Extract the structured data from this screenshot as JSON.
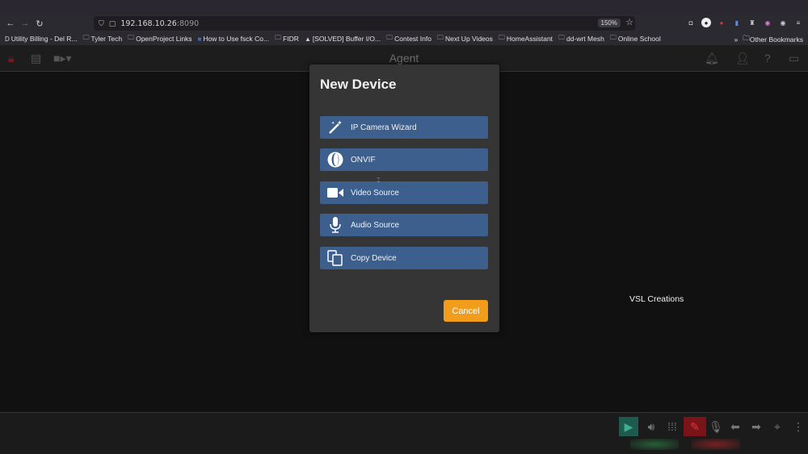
{
  "browser": {
    "url": "192.168.10.26",
    "url_port": ":8090",
    "zoom": "150%",
    "bookmarks": [
      {
        "label": "Utility Billing - Del R...",
        "icon": "D"
      },
      {
        "label": "Tyler Tech",
        "icon": "folder"
      },
      {
        "label": "OpenProject Links",
        "icon": "folder"
      },
      {
        "label": "How to Use fsck Co...",
        "icon": "page"
      },
      {
        "label": "FIDR",
        "icon": "folder"
      },
      {
        "label": "[SOLVED] Buffer I/O...",
        "icon": "arch"
      },
      {
        "label": "Contest Info",
        "icon": "folder"
      },
      {
        "label": "Next Up Videos",
        "icon": "folder"
      },
      {
        "label": "HomeAssistant",
        "icon": "folder"
      },
      {
        "label": "dd-wrt Mesh",
        "icon": "folder"
      },
      {
        "label": "Online School",
        "icon": "folder"
      }
    ],
    "other_bookmarks": "Other Bookmarks"
  },
  "app": {
    "title": "Agent"
  },
  "dialog": {
    "title": "New Device",
    "options": [
      {
        "label": "IP Camera Wizard",
        "icon": "magic-wand-icon"
      },
      {
        "label": "ONVIF",
        "icon": "onvif-icon"
      },
      {
        "label": "Video Source",
        "icon": "video-camera-icon"
      },
      {
        "label": "Audio Source",
        "icon": "microphone-icon"
      },
      {
        "label": "Copy Device",
        "icon": "copy-icon"
      }
    ],
    "cancel_label": "Cancel"
  },
  "watermark": "VSL Creations",
  "colors": {
    "option_bg": "#3d5f8e",
    "cancel_bg": "#f19c1b",
    "dialog_bg": "#353535"
  }
}
